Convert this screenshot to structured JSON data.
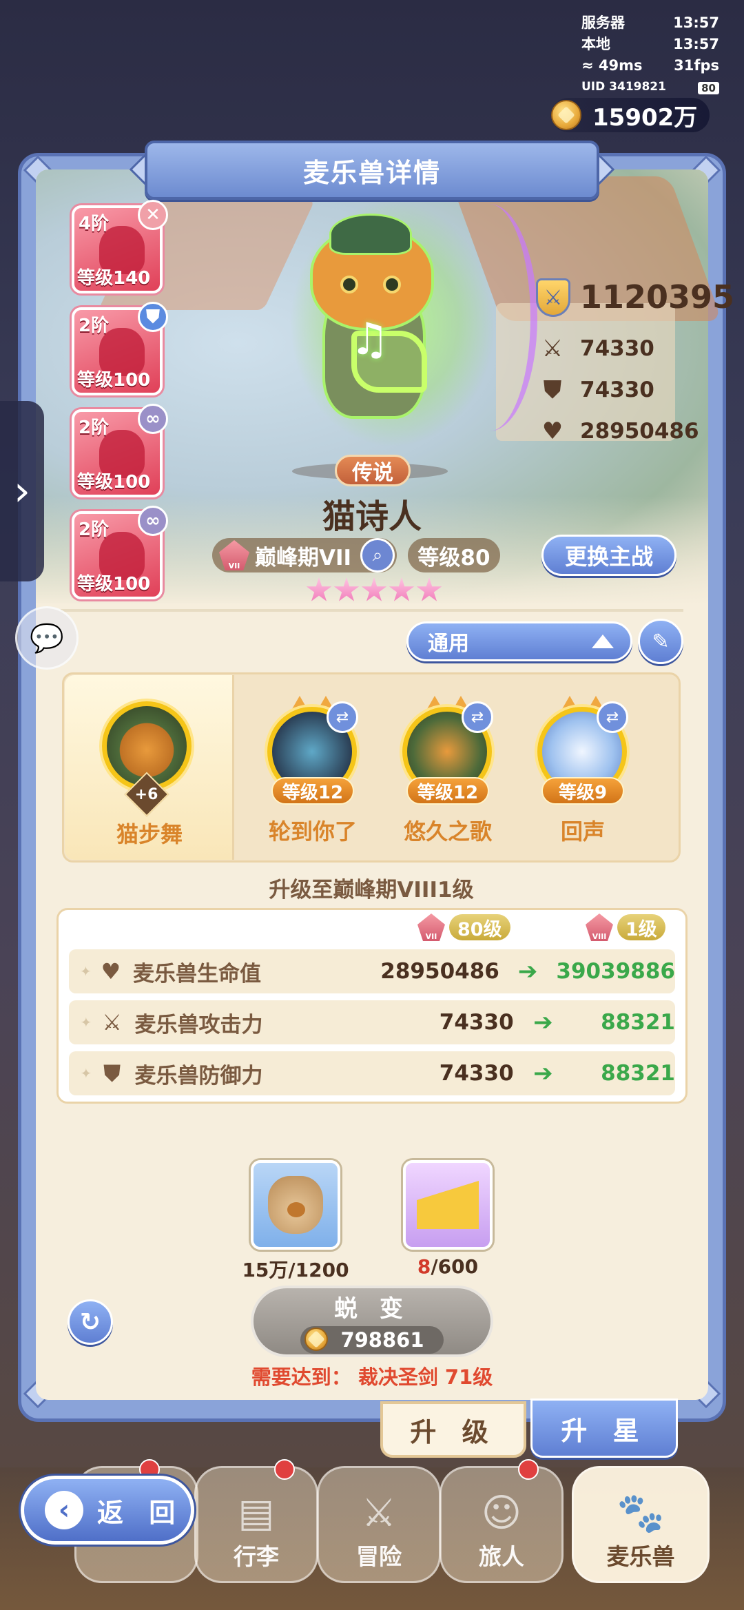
{
  "status": {
    "server_label": "服务器",
    "server_time": "13:57",
    "local_label": "本地",
    "local_time": "13:57",
    "ping": "49ms",
    "fps": "31fps",
    "uid": "UID 3419821",
    "battery": "80"
  },
  "currency": {
    "amount": "15902万"
  },
  "header": {
    "title": "麦乐兽详情"
  },
  "team": [
    {
      "tier": "4阶",
      "level": "等级140",
      "badge": "✕",
      "badge_color": "#f0a0a8"
    },
    {
      "tier": "2阶",
      "level": "等级100",
      "badge": "⛊",
      "badge_color": "#5b8be0"
    },
    {
      "tier": "2阶",
      "level": "等级100",
      "badge": "∞",
      "badge_color": "#9a90c8"
    },
    {
      "tier": "2阶",
      "level": "等级100",
      "badge": "∞",
      "badge_color": "#9a90c8"
    }
  ],
  "pet": {
    "power": "1120395",
    "attack": "74330",
    "defense": "74330",
    "hp": "28950486",
    "rarity": "传说",
    "name": "猫诗人",
    "peak": "巅峰期VII",
    "peak_emblem": "VII",
    "level": "等级80",
    "switch_label": "更换主战",
    "stars": 5
  },
  "preset": {
    "selected": "通用"
  },
  "skills": {
    "main": {
      "name": "猫步舞",
      "bonus": "+6"
    },
    "items": [
      {
        "name": "轮到你了",
        "level": "等级12"
      },
      {
        "name": "悠久之歌",
        "level": "等级12"
      },
      {
        "name": "回声",
        "level": "等级9"
      }
    ]
  },
  "upgrade": {
    "title": "升级至巅峰期VIII1级",
    "current": {
      "emblem": "VII",
      "badge": "80级"
    },
    "next": {
      "emblem": "VIII",
      "badge": "1级"
    },
    "rows": [
      {
        "label": "麦乐兽生命值",
        "icon": "heart-icon",
        "from": "28950486",
        "to": "39039886"
      },
      {
        "label": "麦乐兽攻击力",
        "icon": "sword-icon",
        "from": "74330",
        "to": "88321"
      },
      {
        "label": "麦乐兽防御力",
        "icon": "shield-icon",
        "from": "74330",
        "to": "88321"
      }
    ]
  },
  "materials": [
    {
      "icon": "food-bag-icon",
      "have": "15万",
      "need": "/1200"
    },
    {
      "icon": "cheese-icon",
      "have": "8",
      "need": "/600",
      "have_color": "#d23a2a"
    }
  ],
  "evolve": {
    "label": "蜕 变",
    "cost": "798861"
  },
  "requirement": "需要达到：  裁决圣剑  71级",
  "tabs": {
    "upgrade": "升 级",
    "star": "升 星"
  },
  "nav": {
    "back": "返 回",
    "items": [
      "行李",
      "冒险",
      "旅人",
      "麦乐兽"
    ]
  }
}
